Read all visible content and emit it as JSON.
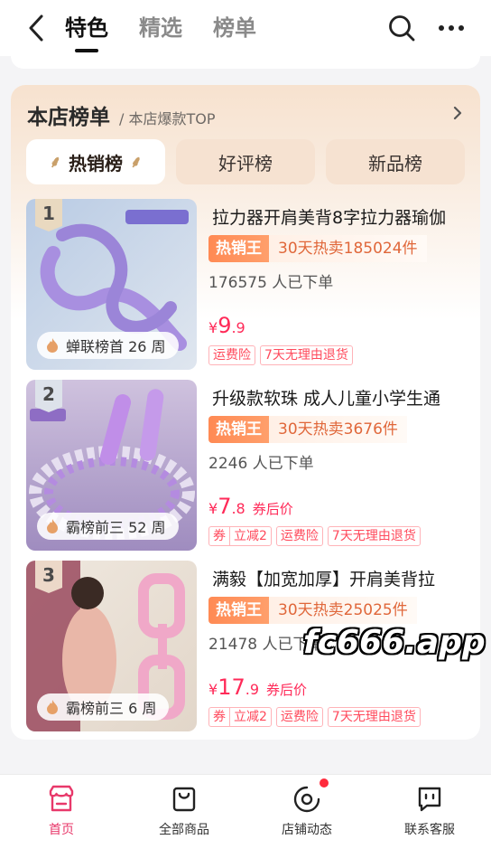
{
  "header": {
    "tabs": [
      {
        "label": "特色",
        "active": true
      },
      {
        "label": "精选",
        "active": false
      },
      {
        "label": "榜单",
        "active": false
      }
    ]
  },
  "ranking": {
    "title": "本店榜单",
    "subtitle": "/ 本店爆款TOP",
    "tabs": [
      {
        "label": "热销榜",
        "active": true
      },
      {
        "label": "好评榜",
        "active": false
      },
      {
        "label": "新品榜",
        "active": false
      }
    ],
    "items": [
      {
        "rank": "1",
        "title": "拉力器开肩美背8字拉力器瑜伽",
        "hot_badge": "热销王",
        "hot_sales": "30天热卖185024件",
        "ordered": "176575 人已下单",
        "price_cur": "¥",
        "price_int": "9",
        "price_dec": ".9",
        "price_after": "",
        "tags": [
          "运费险",
          "7天无理由退货"
        ],
        "coupon": null,
        "pill": "蝉联榜首 26 周"
      },
      {
        "rank": "2",
        "title": "升级款软珠 成人儿童小学生通",
        "hot_badge": "热销王",
        "hot_sales": "30天热卖3676件",
        "ordered": "2246 人已下单",
        "price_cur": "¥",
        "price_int": "7",
        "price_dec": ".8",
        "price_after": "券后价",
        "tags": [
          "运费险",
          "7天无理由退货"
        ],
        "coupon": {
          "a": "券",
          "b": "立减2"
        },
        "pill": "霸榜前三 52 周"
      },
      {
        "rank": "3",
        "title": "满毅【加宽加厚】开肩美背拉",
        "hot_badge": "热销王",
        "hot_sales": "30天热卖25025件",
        "ordered": "21478 人已下单",
        "price_cur": "¥",
        "price_int": "17",
        "price_dec": ".9",
        "price_after": "券后价",
        "tags": [
          "运费险",
          "7天无理由退货"
        ],
        "coupon": {
          "a": "券",
          "b": "立减2"
        },
        "pill": "霸榜前三 6 周"
      }
    ]
  },
  "watermark": "fc666.app",
  "bottom_nav": [
    {
      "label": "首页",
      "icon": "store-icon",
      "active": true
    },
    {
      "label": "全部商品",
      "icon": "bag-icon",
      "active": false
    },
    {
      "label": "店铺动态",
      "icon": "target-icon",
      "active": false,
      "dot": true
    },
    {
      "label": "联系客服",
      "icon": "chat-icon",
      "active": false
    }
  ],
  "colors": {
    "accent": "#ff2a58",
    "hot": "#ff8a54",
    "nav_active": "#e8386a"
  }
}
